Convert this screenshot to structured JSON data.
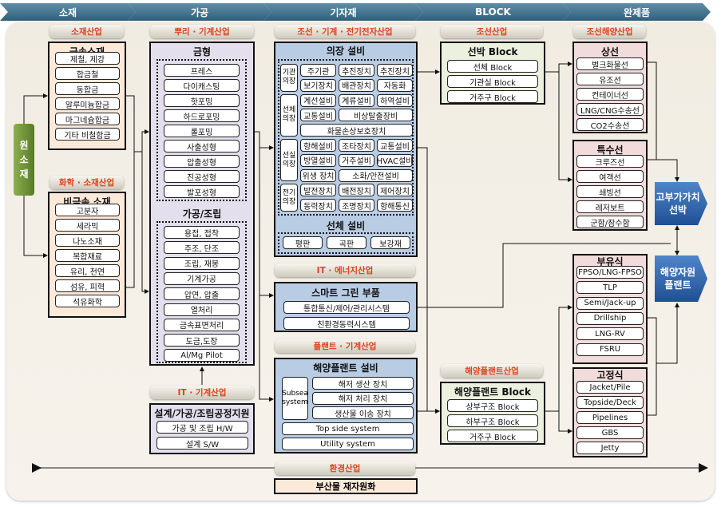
{
  "stages": [
    "소재",
    "가공",
    "기자재",
    "BLOCK",
    "완제품"
  ],
  "raw_material": "원\n소\n재",
  "colors": {
    "stage": "#3f6f8a",
    "industry_text": "#e0401a",
    "material": "#fde9d9",
    "processing": "#e4dfec",
    "equipment": "#b8cce4",
    "block": "#ebf1de",
    "product": "#f2dcdb",
    "goal": "#2f63ad",
    "raw": "#6e9236"
  },
  "sections": {
    "metal": {
      "industry": "소재산업",
      "title": "금속소재",
      "items": [
        "제철, 제강",
        "합금철",
        "동합금",
        "알루미늄합금",
        "마그네슘합금",
        "기타 비철합금"
      ]
    },
    "nonmetal": {
      "industry": "화학 · 소재산업",
      "title": "비금속 소재",
      "items": [
        "고분자",
        "세라믹",
        "나노소재",
        "복합재료",
        "유리, 천연",
        "섬유, 피혁",
        "석유화학"
      ]
    },
    "root": {
      "industry": "뿌리 · 기계산업",
      "title": "금형",
      "items": [
        "프레스",
        "다이캐스팅",
        "핫포밍",
        "하드로포밍",
        "롤포밍",
        "사출성형",
        "압출성형",
        "진공성형",
        "발포성형"
      ],
      "title2": "가공/조립",
      "items2": [
        "용접, 접착",
        "주조, 단조",
        "조립, 재봉",
        "기계가공",
        "압연, 압출",
        "열처리",
        "금속표면처리",
        "도금,도장",
        "Al/Mg Pilot"
      ]
    },
    "process_support": {
      "industry": "IT · 기계산업",
      "title": "설계/가공/조립공정지원",
      "items": [
        "가공 및 조립 H/W",
        "설계 S/W"
      ]
    },
    "outfitting": {
      "industry": "조선 · 기계 · 전기전자산업",
      "title": "의장 설비",
      "groups": [
        {
          "label": "기관\n의장",
          "rows": [
            [
              "주기관",
              "추진장치",
              "추진장치"
            ],
            [
              "보기장치",
              "배관장치",
              "자동화"
            ]
          ]
        },
        {
          "label": "선체\n의장",
          "rows": [
            [
              "계선설비",
              "계류설비",
              "하역설비"
            ],
            [
              "교통설비",
              "비상탈출장비"
            ],
            [
              "화물손상보호장치"
            ]
          ]
        },
        {
          "label": "선실\n의장",
          "rows": [
            [
              "항해설비",
              "조타장치",
              "교통설비"
            ],
            [
              "방열설비",
              "거주설비",
              "HVAC설비"
            ],
            [
              "위생 장치",
              "소화/안전설비"
            ]
          ]
        },
        {
          "label": "전기\n의장",
          "rows": [
            [
              "발전장치",
              "배전장치",
              "제어장치"
            ],
            [
              "동력장치",
              "조명장치",
              "항해통신"
            ]
          ]
        }
      ],
      "title2": "선체 설비",
      "items2": [
        "평판",
        "곡판",
        "보강재"
      ]
    },
    "smart": {
      "industry": "IT · 에너지산업",
      "title": "스마트 그린 부품",
      "items": [
        "통합통신/제어/관리시스템",
        "친환경동력시스템"
      ]
    },
    "offshore_eq": {
      "industry": "플랜트 · 기계산업",
      "title": "해양플랜트 설비",
      "subsea_label": "Subsea\nsystem",
      "subsea_items": [
        "해저 생산 장치",
        "해저 처리 장치",
        "생산물 이송 장치"
      ],
      "items": [
        "Top side system",
        "Utility system"
      ]
    },
    "env": {
      "industry": "환경산업",
      "title": "부산물 재자원화"
    },
    "ship_block": {
      "industry": "조선산업",
      "title": "선박 Block",
      "items": [
        "선체 Block",
        "기관실 Block",
        "거주구 Block"
      ]
    },
    "plant_block": {
      "industry": "해양플랜트산업",
      "title": "해양플랜트 Block",
      "items": [
        "상부구조 Block",
        "하부구조 Block",
        "거주구 Block"
      ]
    },
    "merchant": {
      "industry": "조선해양산업",
      "title": "상선",
      "items": [
        "벌크화물선",
        "유조선",
        "컨테이너선",
        "LNG/CNG수송선",
        "CO2수송선"
      ]
    },
    "special": {
      "title": "특수선",
      "items": [
        "크루즈선",
        "여객선",
        "쇄빙선",
        "레저보트",
        "군함/잠수함"
      ]
    },
    "floating": {
      "title": "부유식",
      "items": [
        "FPSO/LNG-FPSO",
        "TLP",
        "Semi/Jack-up",
        "Drillship",
        "LNG-RV",
        "FSRU"
      ]
    },
    "fixed": {
      "title": "고정식",
      "items": [
        "Jacket/Pile",
        "Topside/Deck",
        "Pipelines",
        "GBS",
        "Jetty"
      ]
    }
  },
  "goals": [
    "고부가가치\n선박",
    "해양자원\n플랜트"
  ]
}
